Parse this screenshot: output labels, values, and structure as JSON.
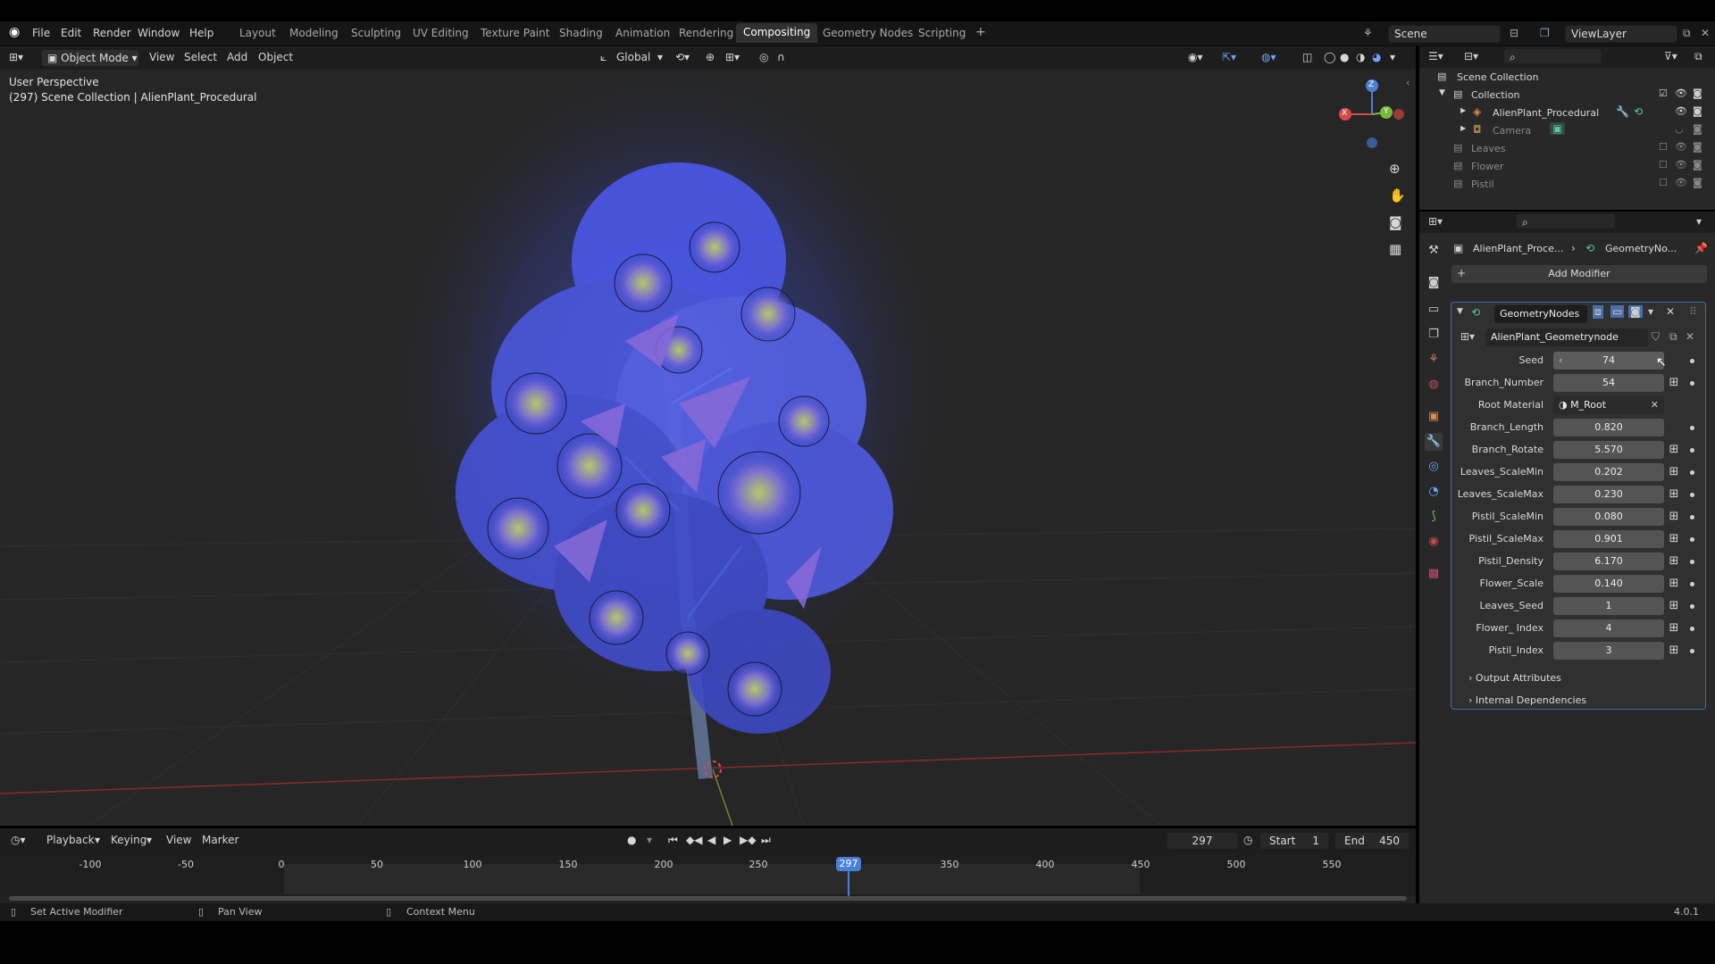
{
  "menu": {
    "file": "File",
    "edit": "Edit",
    "render": "Render",
    "window": "Window",
    "help": "Help"
  },
  "workspaces": [
    "Layout",
    "Modeling",
    "Sculpting",
    "UV Editing",
    "Texture Paint",
    "Shading",
    "Animation",
    "Rendering",
    "Compositing",
    "Geometry Nodes",
    "Scripting"
  ],
  "active_workspace": "Compositing",
  "scene": {
    "name": "Scene",
    "view_layer": "ViewLayer"
  },
  "viewport": {
    "mode": "Object Mode",
    "menus": [
      "View",
      "Select",
      "Add",
      "Object"
    ],
    "orientation": "Global",
    "perspective": "User Perspective",
    "context": "(297) Scene Collection | AlienPlant_Procedural",
    "gizmo": {
      "x": "X",
      "y": "Y",
      "z": "Z"
    }
  },
  "outliner": {
    "root": "Scene Collection",
    "collection": "Collection",
    "items": [
      {
        "label": "AlienPlant_Procedural",
        "dim": false
      },
      {
        "label": "Camera",
        "dim": true
      },
      {
        "label": "Leaves",
        "dim": true
      },
      {
        "label": "Flower",
        "dim": true
      },
      {
        "label": "Pistil",
        "dim": true
      }
    ]
  },
  "properties": {
    "breadcrumb_object": "AlienPlant_Proce...",
    "breadcrumb_modifier": "GeometryNo...",
    "add_modifier": "Add Modifier",
    "modifier_name": "GeometryNodes",
    "node_group": "AlienPlant_Geometrynode",
    "params": [
      {
        "label": "Seed",
        "value": "74"
      },
      {
        "label": "Branch_Number",
        "value": "54"
      },
      {
        "label": "Root Material",
        "value": "M_Root"
      },
      {
        "label": "Branch_Length",
        "value": "0.820"
      },
      {
        "label": "Branch_Rotate",
        "value": "5.570"
      },
      {
        "label": "Leaves_ScaleMin",
        "value": "0.202"
      },
      {
        "label": "Leaves_ScaleMax",
        "value": "0.230"
      },
      {
        "label": "Pistil_ScaleMin",
        "value": "0.080"
      },
      {
        "label": "Pistil_ScaleMax",
        "value": "0.901"
      },
      {
        "label": "Pistil_Density",
        "value": "6.170"
      },
      {
        "label": "Flower_Scale",
        "value": "0.140"
      },
      {
        "label": "Leaves_Seed",
        "value": "1"
      },
      {
        "label": "Flower_ Index",
        "value": "4"
      },
      {
        "label": "Pistil_Index",
        "value": "3"
      }
    ],
    "sections": [
      "Output Attributes",
      "Internal Dependencies"
    ]
  },
  "timeline": {
    "menus": [
      "Playback",
      "Keying",
      "View",
      "Marker"
    ],
    "current_frame": "297",
    "start_label": "Start",
    "start": "1",
    "end_label": "End",
    "end": "450",
    "ticks": [
      "-100",
      "-50",
      "0",
      "50",
      "100",
      "150",
      "200",
      "250",
      "297",
      "350",
      "400",
      "450",
      "500",
      "550"
    ]
  },
  "status": {
    "left": "Set Active Modifier",
    "middle": "Pan View",
    "right": "Context Menu",
    "version": "4.0.1"
  }
}
